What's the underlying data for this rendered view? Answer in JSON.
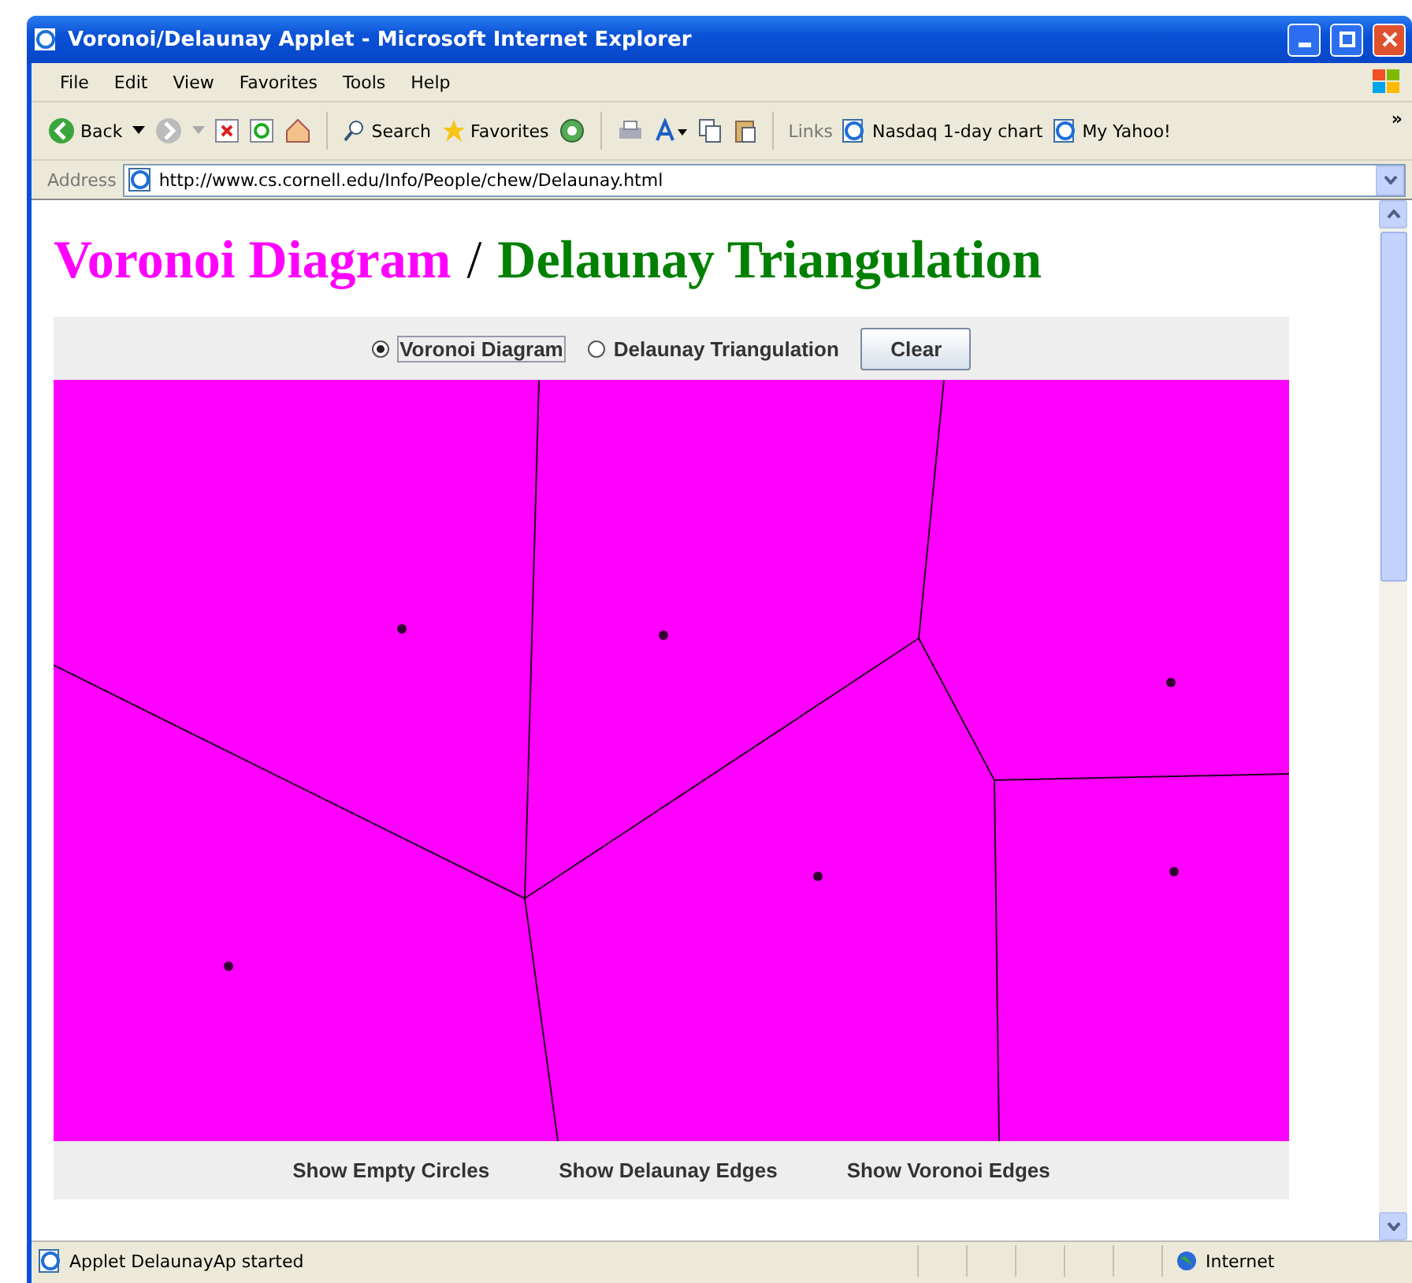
{
  "window": {
    "title": "Voronoi/Delaunay Applet - Microsoft Internet Explorer"
  },
  "menu": [
    "File",
    "Edit",
    "View",
    "Favorites",
    "Tools",
    "Help"
  ],
  "toolbar": {
    "back": "Back",
    "search": "Search",
    "favorites": "Favorites",
    "links_label": "Links",
    "links": [
      "Nasdaq 1-day chart",
      "My Yahoo!"
    ],
    "more": "»"
  },
  "address": {
    "label": "Address",
    "value": "http://www.cs.cornell.edu/Info/People/chew/Delaunay.html"
  },
  "heading": {
    "first": "Voronoi Diagram",
    "separator": "/",
    "second": "Delaunay Triangulation"
  },
  "applet": {
    "modes": [
      {
        "label": "Voronoi Diagram",
        "selected": true
      },
      {
        "label": "Delaunay Triangulation",
        "selected": false
      }
    ],
    "clear_button": "Clear",
    "options": [
      "Show Empty Circles",
      "Show Delaunay Edges",
      "Show Voronoi Edges"
    ]
  },
  "status_bar": {
    "text": "Applet DelaunayAp started",
    "zone": "Internet"
  }
}
